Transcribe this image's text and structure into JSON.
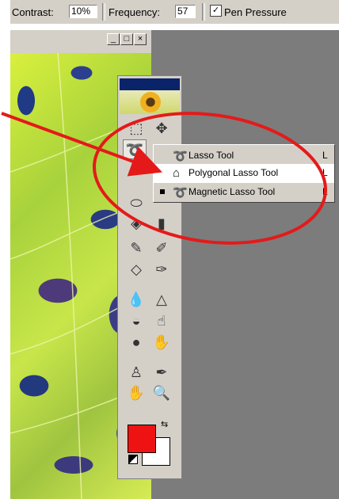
{
  "options_bar": {
    "contrast_label": "Contrast:",
    "contrast_value": "10%",
    "frequency_label": "Frequency:",
    "frequency_value": "57",
    "pen_pressure_label": "Pen Pressure",
    "pen_pressure_checked": true
  },
  "image_window": {
    "minimize_label": "_",
    "maximize_label": "□",
    "close_label": "×"
  },
  "toolbox": {
    "tools": [
      "marquee-tool",
      "move-tool",
      "lasso-tool",
      "magic-wand-tool",
      "crop-tool",
      "slice-tool",
      "healing-brush-tool",
      "gradient-tool",
      "brush-tool",
      "pencil-tool",
      "eraser-tool",
      "history-brush-tool",
      "blur-tool",
      "sharpen-tool",
      "smudge-tool",
      "dodge-tool",
      "burn-tool",
      "sponge-tool",
      "clone-stamp-tool",
      "eyedropper-tool",
      "hand-tool",
      "zoom-tool"
    ],
    "foreground_color": "#ee1212",
    "background_color": "#ffffff"
  },
  "flyout_menu": {
    "items": [
      {
        "label": "Lasso Tool",
        "shortcut": "L",
        "icon": "lasso-icon",
        "active": false
      },
      {
        "label": "Polygonal Lasso Tool",
        "shortcut": "L",
        "icon": "polygonal-lasso-icon",
        "highlighted": true
      },
      {
        "label": "Magnetic Lasso Tool",
        "shortcut": "L",
        "icon": "magnetic-lasso-icon",
        "active": true
      }
    ]
  },
  "annotation": {
    "arrow_color": "#e41a1a",
    "ellipse_color": "#e41a1a"
  }
}
